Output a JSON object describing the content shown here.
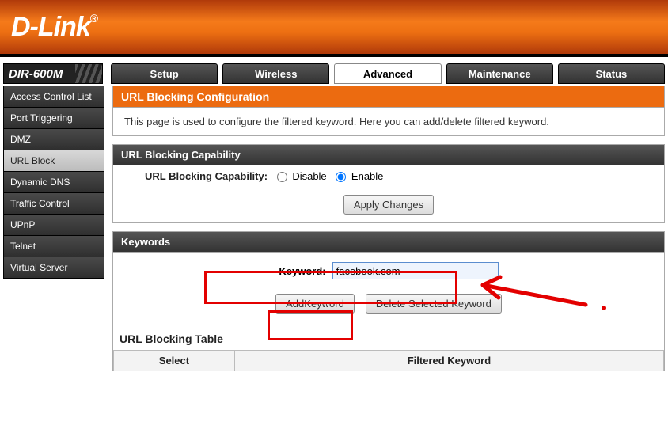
{
  "brand": "D-Link",
  "model": "DIR-600M",
  "tabs": [
    "Setup",
    "Wireless",
    "Advanced",
    "Maintenance",
    "Status"
  ],
  "active_tab_index": 2,
  "sidebar": {
    "items": [
      "Access Control List",
      "Port Triggering",
      "DMZ",
      "URL Block",
      "Dynamic DNS",
      "Traffic Control",
      "UPnP",
      "Telnet",
      "Virtual Server"
    ],
    "active_index": 3
  },
  "config": {
    "title": "URL Blocking Configuration",
    "desc": "This page is used to configure the filtered keyword. Here you can add/delete filtered keyword."
  },
  "capability": {
    "header": "URL Blocking Capability",
    "label": "URL Blocking Capability:",
    "option_disable": "Disable",
    "option_enable": "Enable",
    "selected": "enable",
    "apply_btn": "Apply Changes"
  },
  "keywords": {
    "header": "Keywords",
    "label": "Keyword:",
    "value": "facebook.com",
    "add_btn": "AddKeyword",
    "del_btn": "Delete Selected Keyword"
  },
  "table": {
    "title": "URL Blocking Table",
    "cols": [
      "Select",
      "Filtered Keyword"
    ]
  }
}
